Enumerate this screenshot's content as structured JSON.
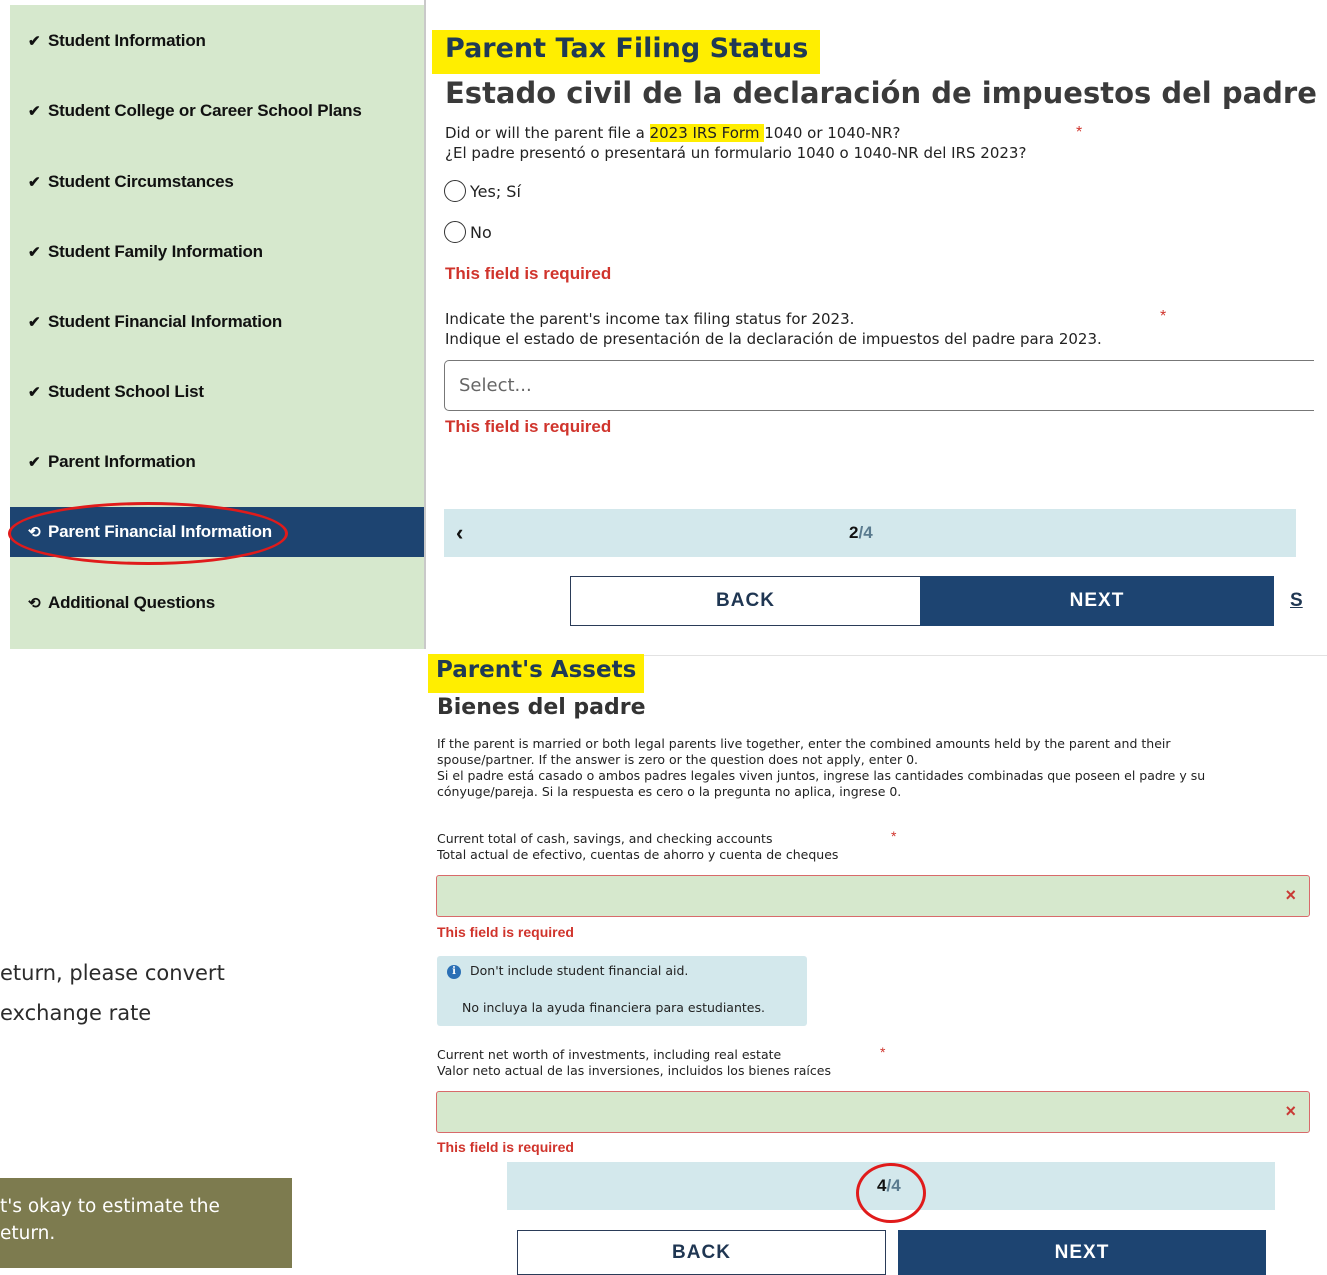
{
  "sidebar": {
    "items": [
      {
        "label": "Student Information",
        "icon": "check-icon",
        "glyph": "✔"
      },
      {
        "label": "Student College or Career School Plans",
        "icon": "check-icon",
        "glyph": "✔"
      },
      {
        "label": "Student Circumstances",
        "icon": "check-icon",
        "glyph": "✔"
      },
      {
        "label": "Student Family Information",
        "icon": "check-icon",
        "glyph": "✔"
      },
      {
        "label": "Student Financial Information",
        "icon": "check-icon",
        "glyph": "✔"
      },
      {
        "label": "Student School List",
        "icon": "check-icon",
        "glyph": "✔"
      },
      {
        "label": "Parent Information",
        "icon": "check-icon",
        "glyph": "✔"
      },
      {
        "label": "Parent Financial Information",
        "icon": "history-icon",
        "glyph": "⟲",
        "active": true
      },
      {
        "label": "Additional Questions",
        "icon": "history-icon",
        "glyph": "⟲"
      }
    ]
  },
  "panel1": {
    "title": "Parent Tax Filing Status",
    "subtitle": "Estado civil de la declaración de impuestos del padre",
    "q1_pre": "Did or will the parent file a ",
    "q1_highlight": "2023 IRS Form ",
    "q1_post": "1040 or 1040-NR?",
    "q1_es": "¿El padre presentó o presentará un formulario 1040 o 1040-NR del IRS 2023?",
    "required_mark": "*",
    "yes_label": "Yes; Sí",
    "no_label": "No",
    "error": "This field is required",
    "q2_en": "Indicate the parent's income tax filing status for 2023.",
    "q2_es": "Indique el estado de presentación de la declaración de impuestos del padre para 2023.",
    "select_placeholder": "Select...",
    "pager_prev": "‹",
    "pager_current": "2",
    "pager_total": "/4",
    "back_label": "BACK",
    "next_label": "NEXT",
    "cut_letter": "S"
  },
  "panel2": {
    "title": "Parent's Assets",
    "subtitle": "Bienes del padre",
    "intro_1": "If the parent is married or both legal parents live together, enter the combined amounts held by the parent and their",
    "intro_2": "spouse/partner. If the answer is zero or the question does not apply, enter 0.",
    "intro_3": "Si el padre está casado o ambos padres legales viven juntos, ingrese las cantidades combinadas que poseen el padre y su",
    "intro_4": "cónyuge/pareja. Si la respuesta es cero o la pregunta no aplica, ingrese 0.",
    "cash_en": "Current total of cash, savings, and checking accounts",
    "cash_es": "Total actual de efectivo, cuentas de ahorro y cuenta de cheques",
    "required_mark": "*",
    "clear_glyph": "×",
    "error": "This field is required",
    "info_en": "Don't include student financial aid.",
    "info_es": "No incluya la ayuda financiera para estudiantes.",
    "info_glyph": "i",
    "invest_en": "Current net worth of investments, including real estate",
    "invest_es": "Valor neto actual de las inversiones, incluidos los bienes raíces",
    "pager_current": "4",
    "pager_total": "/4",
    "back_label": "BACK",
    "next_label": "NEXT"
  },
  "background": {
    "frag_line1": "eturn, please convert",
    "frag_line2": " exchange rate",
    "note_line1": "t's okay to estimate the",
    "note_line2": "eturn."
  },
  "colors": {
    "sidebar_bg": "#d6e8cd",
    "active_bg": "#1d4471",
    "highlight": "#ffee00",
    "error_red": "#d0342c",
    "pager_bg": "#d3e8ec",
    "annotation_red": "#e01b1b"
  }
}
